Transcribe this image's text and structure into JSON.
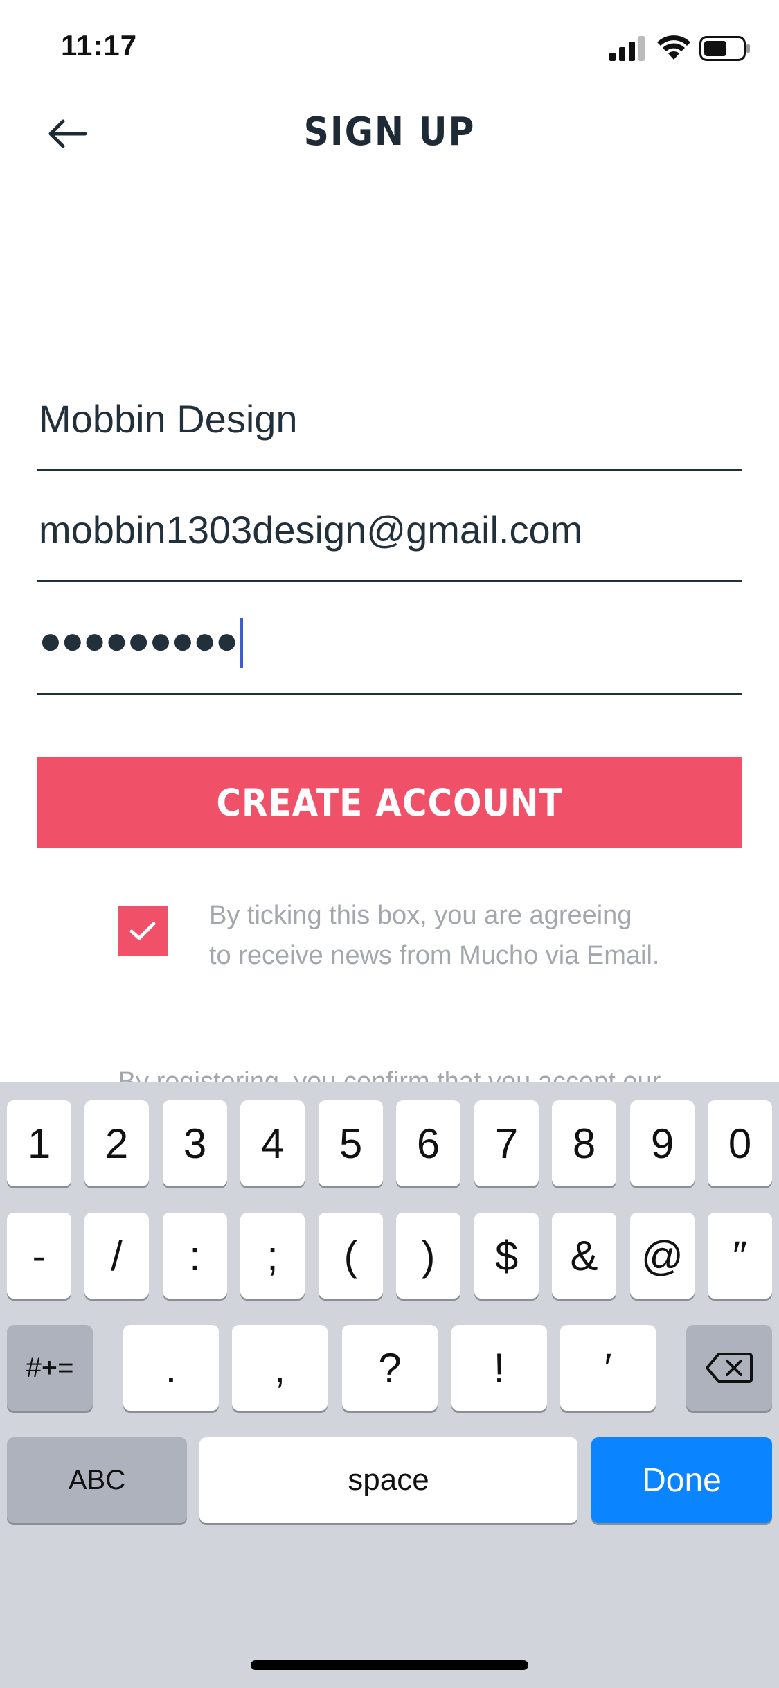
{
  "status_bar": {
    "time": "11:17"
  },
  "header": {
    "title": "SIGN UP"
  },
  "form": {
    "name_value": "Mobbin Design",
    "email_value": "mobbin1303design@gmail.com",
    "password_mask": "●●●●●●●●●"
  },
  "button": {
    "label": "CREATE ACCOUNT"
  },
  "consent": {
    "line1": "By ticking this box, you are agreeing",
    "line2": "to receive news from Mucho via Email.",
    "checked": true
  },
  "terms_partial": "By registering, you confirm that you accept our",
  "keyboard": {
    "row1": [
      "1",
      "2",
      "3",
      "4",
      "5",
      "6",
      "7",
      "8",
      "9",
      "0"
    ],
    "row2": [
      "-",
      "/",
      ":",
      ";",
      "(",
      ")",
      "$",
      "&",
      "@",
      "″"
    ],
    "row3_left": "#+=",
    "row3": [
      ".",
      ",",
      "?",
      "!",
      "′"
    ],
    "abc": "ABC",
    "space": "space",
    "done": "Done"
  },
  "colors": {
    "accent": "#f05068",
    "keyboard_bg": "#d1d4db",
    "done_blue": "#0a84ff"
  }
}
